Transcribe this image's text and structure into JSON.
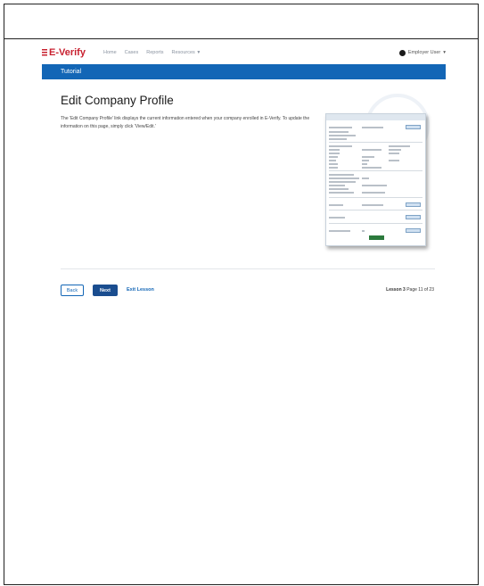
{
  "nav": {
    "logo_text": "E-Verify",
    "links": [
      "Home",
      "Cases",
      "Reports",
      "Resources"
    ],
    "user_label": "Employer User"
  },
  "tutorial_bar": {
    "label": "Tutorial"
  },
  "content": {
    "title": "Edit Company Profile",
    "description": "The 'Edit Company Profile' link displays the current information entered when your company enrolled in E-Verify. To update the information on this page, simply click 'View/Edit.'"
  },
  "footer": {
    "back_label": "Back",
    "next_label": "Next",
    "exit_label": "Exit Lesson",
    "lesson_label": "Lesson 3",
    "page_label": "Page 11 of 23"
  },
  "colors": {
    "brand_blue": "#1366b6",
    "next_button": "#1a4d8f",
    "logo_red": "#c8202f"
  },
  "icons": [
    "flag-icon",
    "user-icon",
    "chevron-down-icon"
  ]
}
